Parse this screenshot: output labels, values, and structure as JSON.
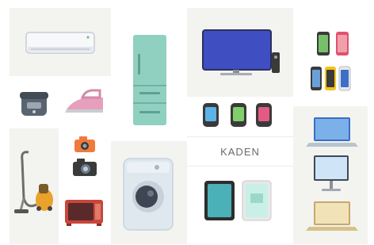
{
  "brand": {
    "label": "KADEN"
  },
  "colors": {
    "panel_light": "#f3f3f0",
    "panel_white": "#ffffff",
    "fridge": "#8fd0c0",
    "tv_screen": "#3f4ec0",
    "washer": "#dfe8ef",
    "microwave": "#c8463a",
    "vacuum": "#e9a22a",
    "camera": "#f07a3c"
  },
  "appliances": [
    "air-conditioner",
    "refrigerator",
    "television",
    "smartphones",
    "rice-cooker",
    "iron",
    "smartwatches",
    "vacuum-cleaner",
    "cameras",
    "washing-machine",
    "microwave",
    "tablets",
    "laptop",
    "desktop-monitor",
    "laptop-gold"
  ]
}
